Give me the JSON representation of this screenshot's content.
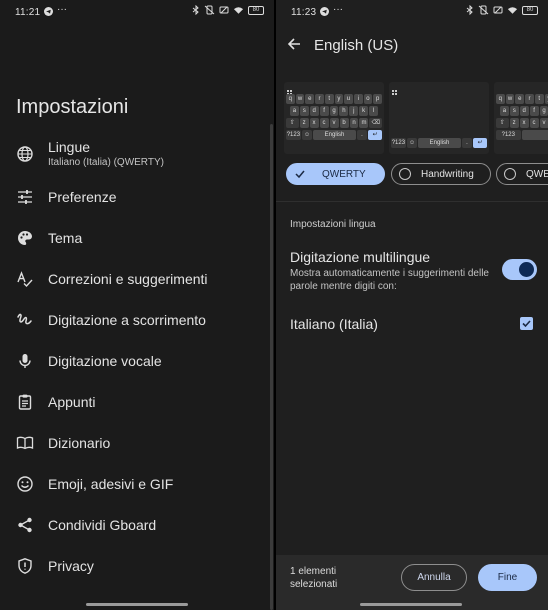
{
  "left": {
    "status": {
      "time": "11:21",
      "battery": "80"
    },
    "title": "Impostazioni",
    "menu": [
      {
        "label": "Lingue",
        "sub": "Italiano (Italia) (QWERTY)",
        "icon": "globe-icon"
      },
      {
        "label": "Preferenze",
        "icon": "tune-icon"
      },
      {
        "label": "Tema",
        "icon": "palette-icon"
      },
      {
        "label": "Correzioni e suggerimenti",
        "icon": "spellcheck-icon"
      },
      {
        "label": "Digitazione a scorrimento",
        "icon": "gesture-icon"
      },
      {
        "label": "Digitazione vocale",
        "icon": "microphone-icon"
      },
      {
        "label": "Appunti",
        "icon": "clipboard-icon"
      },
      {
        "label": "Dizionario",
        "icon": "book-icon"
      },
      {
        "label": "Emoji, adesivi e GIF",
        "icon": "emoji-icon"
      },
      {
        "label": "Condividi Gboard",
        "icon": "share-icon"
      },
      {
        "label": "Privacy",
        "icon": "shield-icon"
      }
    ]
  },
  "right": {
    "status": {
      "time": "11:23",
      "battery": "80"
    },
    "title": "English (US)",
    "keyboard": {
      "row1": [
        "q",
        "w",
        "e",
        "r",
        "t",
        "y",
        "u",
        "i",
        "o",
        "p"
      ],
      "row2": [
        "a",
        "s",
        "d",
        "f",
        "g",
        "h",
        "j",
        "k",
        "l"
      ],
      "row3": [
        "z",
        "x",
        "c",
        "v",
        "b",
        "n",
        "m"
      ],
      "numkey": "?123",
      "space_label": "English"
    },
    "layouts": [
      {
        "label": "QWERTY",
        "selected": true
      },
      {
        "label": "Handwriting",
        "selected": false
      },
      {
        "label": "QWER",
        "selected": false
      }
    ],
    "section_label": "Impostazioni lingua",
    "multilingual": {
      "title": "Digitazione multilingue",
      "desc": "Mostra automaticamente i suggerimenti delle parole mentre digiti con:",
      "enabled": true
    },
    "language_option": {
      "label": "Italiano (Italia)",
      "checked": true
    },
    "bottom": {
      "selected_text": "1 elementi selezionati",
      "cancel": "Annulla",
      "done": "Fine"
    }
  },
  "colors": {
    "accent": "#a8c7fa",
    "bg_left": "#1b1b1b",
    "bg_right": "#1f1f1f"
  }
}
